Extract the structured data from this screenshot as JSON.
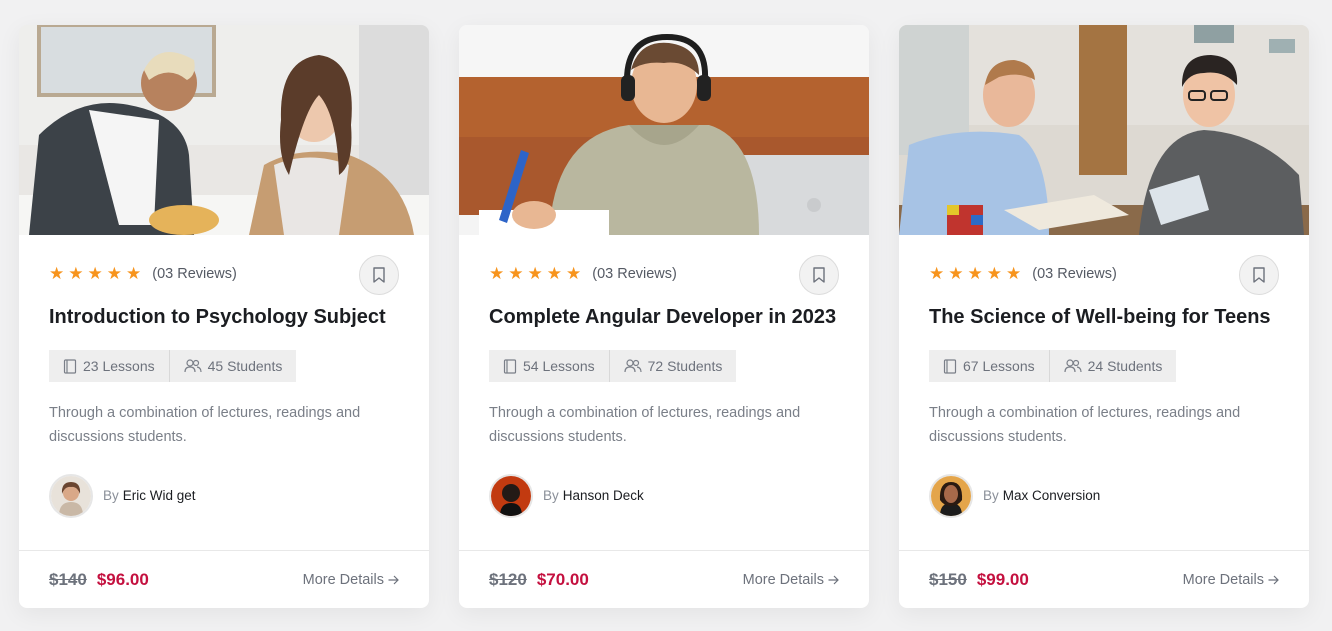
{
  "courses": [
    {
      "image_alt": "two students studying at a table",
      "stars": 5,
      "reviews": "(03 Reviews)",
      "title": "Introduction to Psychology Subject",
      "lessons": "23 Lessons",
      "students": "45 Students",
      "description": "Through a combination of lectures, readings and discussions students.",
      "by_label": "By",
      "author": "Eric Wid get",
      "old_price": "$140",
      "new_price": "$96.00",
      "more_label": "More Details"
    },
    {
      "image_alt": "student with headphones writing",
      "stars": 5,
      "reviews": "(03 Reviews)",
      "title": "Complete Angular Developer in 2023",
      "lessons": "54 Lessons",
      "students": "72 Students",
      "description": "Through a combination of lectures, readings and discussions students.",
      "by_label": "By",
      "author": "Hanson Deck",
      "old_price": "$120",
      "new_price": "$70.00",
      "more_label": "More Details"
    },
    {
      "image_alt": "two young men reading books",
      "stars": 5,
      "reviews": "(03 Reviews)",
      "title": "The Science of Well-being for Teens",
      "lessons": "67 Lessons",
      "students": "24 Students",
      "description": "Through a combination of lectures, readings and discussions students.",
      "by_label": "By",
      "author": "Max Conversion",
      "old_price": "$150",
      "new_price": "$99.00",
      "more_label": "More Details"
    }
  ],
  "colors": {
    "star": "#f7941d",
    "price": "#c4103f",
    "title": "#1b1d21"
  },
  "icons": {
    "star": "star-icon",
    "bookmark": "bookmark-icon",
    "lessons": "book-icon",
    "students": "users-icon",
    "more": "arrow-right-icon"
  }
}
